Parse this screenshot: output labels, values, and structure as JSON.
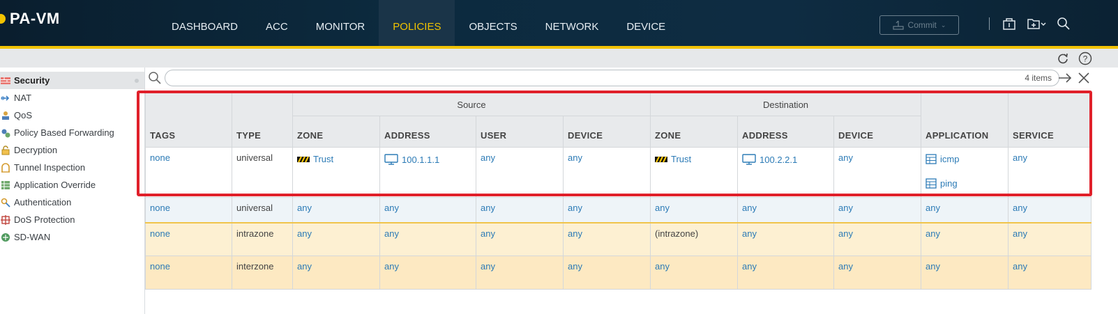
{
  "app": {
    "title": "PA-VM"
  },
  "nav": {
    "items": [
      {
        "label": "DASHBOARD",
        "active": false
      },
      {
        "label": "ACC",
        "active": false
      },
      {
        "label": "MONITOR",
        "active": false
      },
      {
        "label": "POLICIES",
        "active": true
      },
      {
        "label": "OBJECTS",
        "active": false
      },
      {
        "label": "NETWORK",
        "active": false
      },
      {
        "label": "DEVICE",
        "active": false
      }
    ]
  },
  "header": {
    "commit_label": "Commit"
  },
  "sidebar": {
    "items": [
      {
        "label": "Security",
        "icon": "firewall-icon",
        "active": true
      },
      {
        "label": "NAT",
        "icon": "nat-icon"
      },
      {
        "label": "QoS",
        "icon": "qos-icon"
      },
      {
        "label": "Policy Based Forwarding",
        "icon": "pbf-icon"
      },
      {
        "label": "Decryption",
        "icon": "lock-icon"
      },
      {
        "label": "Tunnel Inspection",
        "icon": "tunnel-icon"
      },
      {
        "label": "Application Override",
        "icon": "app-override-icon"
      },
      {
        "label": "Authentication",
        "icon": "auth-icon"
      },
      {
        "label": "DoS Protection",
        "icon": "dos-icon"
      },
      {
        "label": "SD-WAN",
        "icon": "sdwan-icon"
      }
    ]
  },
  "search": {
    "placeholder": "",
    "count": "4 items"
  },
  "table": {
    "groups": {
      "source": "Source",
      "destination": "Destination"
    },
    "columns": {
      "tags": "TAGS",
      "type": "TYPE",
      "src_zone": "ZONE",
      "src_address": "ADDRESS",
      "src_user": "USER",
      "src_device": "DEVICE",
      "dst_zone": "ZONE",
      "dst_address": "ADDRESS",
      "dst_device": "DEVICE",
      "application": "APPLICATION",
      "service": "SERVICE"
    },
    "rows": [
      {
        "tags": "none",
        "type": "universal",
        "src_zone": "Trust",
        "src_address": "100.1.1.1",
        "src_user": "any",
        "src_device": "any",
        "dst_zone": "Trust",
        "dst_address": "100.2.2.1",
        "dst_device": "any",
        "application": [
          "icmp",
          "ping"
        ],
        "service": "any"
      },
      {
        "tags": "none",
        "type": "universal",
        "src_zone": "any",
        "src_address": "any",
        "src_user": "any",
        "src_device": "any",
        "dst_zone": "any",
        "dst_address": "any",
        "dst_device": "any",
        "application": "any",
        "service": "any"
      },
      {
        "tags": "none",
        "type": "intrazone",
        "src_zone": "any",
        "src_address": "any",
        "src_user": "any",
        "src_device": "any",
        "dst_zone": "(intrazone)",
        "dst_address": "any",
        "dst_device": "any",
        "application": "any",
        "service": "any"
      },
      {
        "tags": "none",
        "type": "interzone",
        "src_zone": "any",
        "src_address": "any",
        "src_user": "any",
        "src_device": "any",
        "dst_zone": "any",
        "dst_address": "any",
        "dst_device": "any",
        "application": "any",
        "service": "any"
      }
    ]
  },
  "colors": {
    "accent": "#f2c300",
    "link": "#2c7bb6",
    "highlight": "#e0202a"
  }
}
